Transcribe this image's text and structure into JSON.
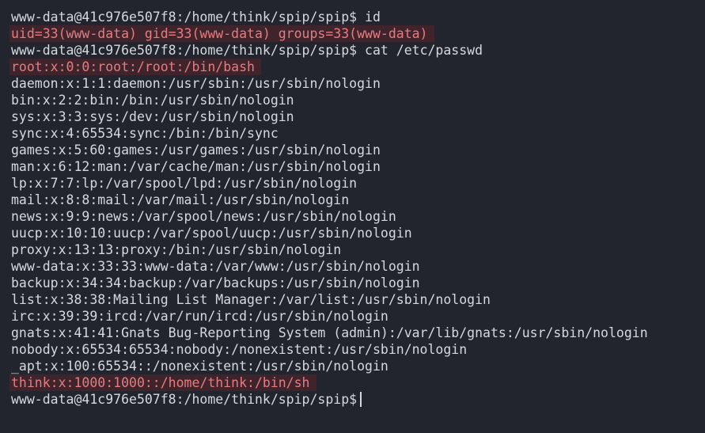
{
  "terminal": {
    "lines": [
      {
        "prompt": "www-data@41c976e507f8:/home/think/spip/spip$",
        "command": " id"
      },
      {
        "output": "uid=33(www-data) gid=33(www-data) groups=33(www-data)",
        "highlight": true
      },
      {
        "prompt": "www-data@41c976e507f8:/home/think/spip/spip$",
        "command": " cat /etc/passwd"
      },
      {
        "output": "root:x:0:0:root:/root:/bin/bash",
        "highlight": true
      },
      {
        "output": "daemon:x:1:1:daemon:/usr/sbin:/usr/sbin/nologin"
      },
      {
        "output": "bin:x:2:2:bin:/bin:/usr/sbin/nologin"
      },
      {
        "output": "sys:x:3:3:sys:/dev:/usr/sbin/nologin"
      },
      {
        "output": "sync:x:4:65534:sync:/bin:/bin/sync"
      },
      {
        "output": "games:x:5:60:games:/usr/games:/usr/sbin/nologin"
      },
      {
        "output": "man:x:6:12:man:/var/cache/man:/usr/sbin/nologin"
      },
      {
        "output": "lp:x:7:7:lp:/var/spool/lpd:/usr/sbin/nologin"
      },
      {
        "output": "mail:x:8:8:mail:/var/mail:/usr/sbin/nologin"
      },
      {
        "output": "news:x:9:9:news:/var/spool/news:/usr/sbin/nologin"
      },
      {
        "output": "uucp:x:10:10:uucp:/var/spool/uucp:/usr/sbin/nologin"
      },
      {
        "output": "proxy:x:13:13:proxy:/bin:/usr/sbin/nologin"
      },
      {
        "output": "www-data:x:33:33:www-data:/var/www:/usr/sbin/nologin"
      },
      {
        "output": "backup:x:34:34:backup:/var/backups:/usr/sbin/nologin"
      },
      {
        "output": "list:x:38:38:Mailing List Manager:/var/list:/usr/sbin/nologin"
      },
      {
        "output": "irc:x:39:39:ircd:/var/run/ircd:/usr/sbin/nologin"
      },
      {
        "output": "gnats:x:41:41:Gnats Bug-Reporting System (admin):/var/lib/gnats:/usr/sbin/nologin"
      },
      {
        "output": "nobody:x:65534:65534:nobody:/nonexistent:/usr/sbin/nologin"
      },
      {
        "output": "_apt:x:100:65534::/nonexistent:/usr/sbin/nologin"
      },
      {
        "output": "think:x:1000:1000::/home/think:/bin/sh",
        "highlight": true
      },
      {
        "prompt": "www-data@41c976e507f8:/home/think/spip/spip$",
        "command": "",
        "cursor": true
      }
    ]
  },
  "colors": {
    "background": "#22252e",
    "text": "#d5d8de",
    "highlight_bg": "#40242c",
    "highlight_text": "#e27d82"
  }
}
